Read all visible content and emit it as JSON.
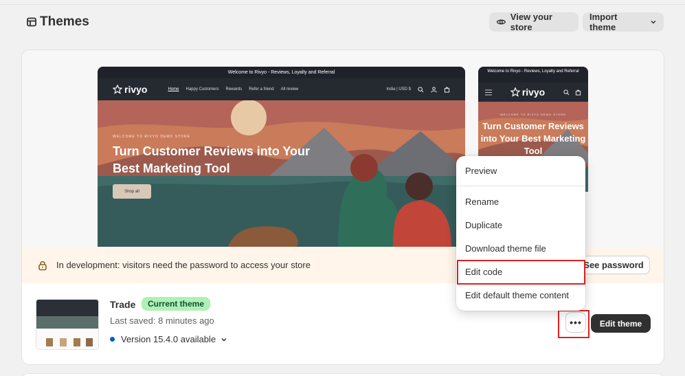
{
  "header": {
    "title": "Themes",
    "view_store": "View your store",
    "import_theme": "Import theme"
  },
  "preview_desktop": {
    "announcement": "Welcome to Rivyo - Reviews, Loyalty and Referral",
    "logo": "rivyo",
    "nav_links": [
      "Home",
      "Happy Customers",
      "Rewards",
      "Refer a friend",
      "All review"
    ],
    "currency": "India | USD $",
    "eyebrow": "WELCOME TO RIVYO DEMO STORE",
    "headline": "Turn Customer Reviews into Your Best Marketing Tool",
    "cta": "Shop all"
  },
  "preview_mobile": {
    "announcement": "Welcome to Rivyo - Reviews, Loyalty and Referral",
    "logo": "rivyo",
    "eyebrow": "WELCOME TO RIVYO DEMO STORE",
    "headline": "Turn Customer Reviews into Your Best Marketing Tool"
  },
  "banner": {
    "text": "In development: visitors need the password to access your store",
    "see_password": "See password"
  },
  "theme": {
    "name": "Trade",
    "badge": "Current theme",
    "last_saved": "Last saved: 8 minutes ago",
    "version": "Version 15.4.0 available",
    "more": "•••",
    "edit": "Edit theme"
  },
  "menu": {
    "items": [
      "Preview",
      "Rename",
      "Duplicate",
      "Download theme file",
      "Edit code",
      "Edit default theme content"
    ]
  },
  "colors": {
    "badge_bg": "#aff0b5",
    "banner_bg": "#fff5ea",
    "highlight": "#e02020",
    "primary_button": "#303030",
    "version_dot": "#005bd3"
  }
}
